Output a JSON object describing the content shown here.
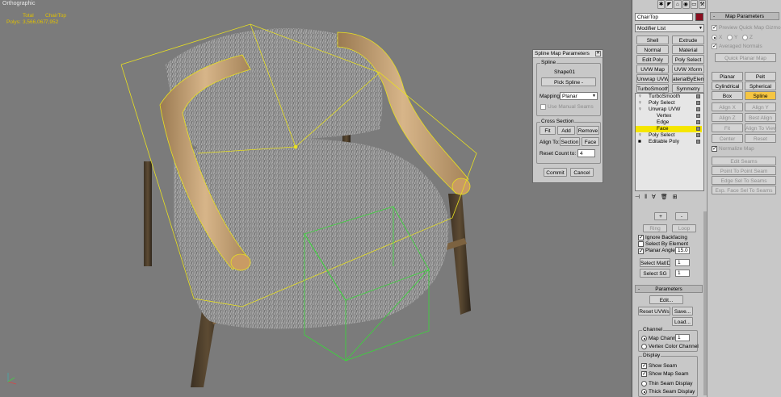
{
  "viewport": {
    "label": "Orthographic",
    "stats": {
      "total_header": "Total",
      "obj_header": "ChairTop",
      "polys_label": "Polys:",
      "polys_total": "3,566,067",
      "polys_obj": "7,952"
    }
  },
  "dialog": {
    "title": "Spline Map Parameters",
    "spline_group": "Spline",
    "shape_name": "Shape01",
    "pick_spline": "Pick Spline -",
    "mapping_label": "Mapping:",
    "mapping_value": "Planar",
    "use_manual_seams": "Use Manual Seams",
    "cross_section_group": "Cross Section",
    "fit": "Fit",
    "add": "Add",
    "remove": "Remove",
    "align_to": "Align To:",
    "section": "Section",
    "face": "Face",
    "reset_count": "Reset Count to:",
    "reset_count_value": "4",
    "commit": "Commit",
    "cancel": "Cancel"
  },
  "modify": {
    "object_name": "ChairTop",
    "object_color": "#8b0d1f",
    "modifier_list": "Modifier List",
    "buttons": [
      "Shell",
      "Extrude",
      "Normal",
      "Material",
      "Edit Poly",
      "Poly Select",
      "UVW Map",
      "UVW Xform",
      "Unwrap UVW",
      "aterialByEleme",
      "TurboSmooth",
      "Symmetry"
    ],
    "stack": [
      "TurboSmooth",
      "Poly Select",
      "Unwrap UVW",
      "Vertex",
      "Edge",
      "Face",
      "Poly Select",
      "Editable Poly"
    ]
  },
  "select": {
    "plus": "+",
    "minus": "-",
    "ring": "Ring",
    "loop": "Loop",
    "ignore_backfacing": "Ignore Backfacing",
    "select_by_element": "Select By Element",
    "planar_angle": "Planar Angle",
    "planar_angle_value": "15.0",
    "select_matid": "Select MatID",
    "matid_value": "1",
    "select_sg": "Select SG",
    "sg_value": "1"
  },
  "parameters": {
    "header": "Parameters",
    "edit": "Edit...",
    "reset_uvws": "Reset UVWs",
    "save": "Save...",
    "load": "Load...",
    "channel_group": "Channel",
    "map_channel": "Map Channel:",
    "map_channel_value": "1",
    "vertex_color_channel": "Vertex Color Channel",
    "display_group": "Display",
    "show_seam": "Show Seam",
    "show_map_seam": "Show Map Seam",
    "thin_seam": "Thin Seam Display",
    "thick_seam": "Thick Seam Display"
  },
  "map_params": {
    "header": "Map Parameters",
    "preview_gizmo": "Preview Quick Map Gizmo",
    "x": "X",
    "y": "Y",
    "z": "Z",
    "averaged_normals": "Averaged Normals",
    "quick_planar": "Quick Planar Map",
    "planar": "Planar",
    "pelt": "Pelt",
    "cylindrical": "Cylindrical",
    "spherical": "Spherical",
    "box": "Box",
    "spline": "Spline",
    "align_x": "Align X",
    "align_y": "Align Y",
    "align_z": "Align Z",
    "best_align": "Best Align",
    "fit": "Fit",
    "align_to_view": "Align To View",
    "center": "Center",
    "reset": "Reset",
    "normalize_map": "Normalize Map",
    "edit_seams": "Edit Seams",
    "point_to_point": "Point To Point Seam",
    "edge_sel_to_seams": "Edge Sel To Seams",
    "exp_face_sel": "Exp. Face Sel To Seams"
  }
}
